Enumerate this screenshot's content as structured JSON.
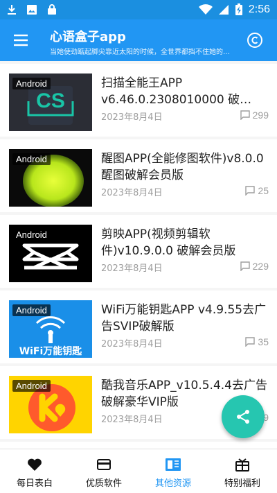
{
  "status_bar": {
    "time": "2:56"
  },
  "app_bar": {
    "title": "心语盒子app",
    "subtitle": "当她使劲踮起脚尖靠近太阳的时候，全世界都挡不住她的阳…"
  },
  "posts": [
    {
      "badge": "Android",
      "title": "扫描全能王APP v6.46.0.2308010000 破…",
      "date": "2023年8月4日",
      "comments": "299",
      "thumb": "camscanner"
    },
    {
      "badge": "Android",
      "title": "醒图APP(全能修图软件)v8.0.0醒图破解会员版",
      "date": "2023年8月4日",
      "comments": "25",
      "thumb": "xingtu"
    },
    {
      "badge": "Android",
      "title": "剪映APP(视频剪辑软件)v10.9.0.0 破解会员版",
      "date": "2023年8月4日",
      "comments": "229",
      "thumb": "capcut"
    },
    {
      "badge": "Android",
      "title": "WiFi万能钥匙APP v4.9.55去广告SVIP破解版",
      "date": "2023年8月4日",
      "comments": "35",
      "thumb": "wifi",
      "thumb_text": "WiFi万能钥匙"
    },
    {
      "badge": "Android",
      "title": "酷我音乐APP_v10.5.4.4去广告破解豪华VIP版",
      "date": "2023年8月4日",
      "comments": "9",
      "thumb": "kuwo"
    }
  ],
  "bottom_nav": [
    {
      "label": "每日表白",
      "icon": "heart-icon"
    },
    {
      "label": "优质软件",
      "icon": "card-icon"
    },
    {
      "label": "其他资源",
      "icon": "book-icon",
      "active": true
    },
    {
      "label": "特别福利",
      "icon": "gift-icon"
    }
  ],
  "colors": {
    "primary": "#2196f3",
    "status_bar": "#1b8fe0",
    "fab": "#26c6b0"
  }
}
